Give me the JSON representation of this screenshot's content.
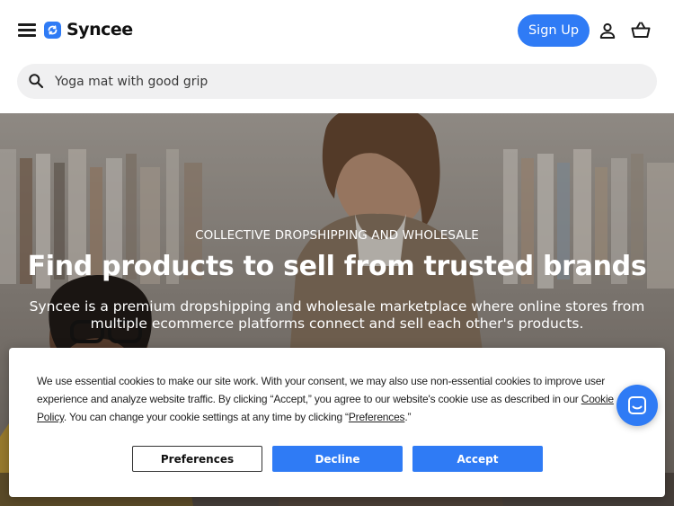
{
  "header": {
    "brand": "Syncee",
    "signup_label": "Sign Up",
    "icons": [
      "menu-icon",
      "user-icon",
      "cart-icon"
    ],
    "accent_color": "#2f7bf5"
  },
  "search": {
    "placeholder": "Yoga mat with good grip"
  },
  "hero": {
    "eyebrow": "COLLECTIVE DROPSHIPPING AND WHOLESALE",
    "title": "Find products to sell from trusted brands",
    "subtitle": "Syncee is a premium dropshipping and wholesale marketplace where online stores from multiple ecommerce platforms connect and sell each other's products."
  },
  "cookie_banner": {
    "text_part1": "We use essential cookies to make our site work. With your consent, we may also use non-essential cookies to improve user experience and analyze website traffic. By clicking “Accept,” you agree to our website's cookie use as described in our ",
    "policy_link": "Cookie Policy",
    "text_part2": ". You can change your cookie settings at any time by clicking “",
    "preferences_link": "Preferences",
    "text_part3": ".”",
    "buttons": {
      "preferences": "Preferences",
      "decline": "Decline",
      "accept": "Accept"
    }
  },
  "chat": {
    "icon": "chat-icon"
  }
}
